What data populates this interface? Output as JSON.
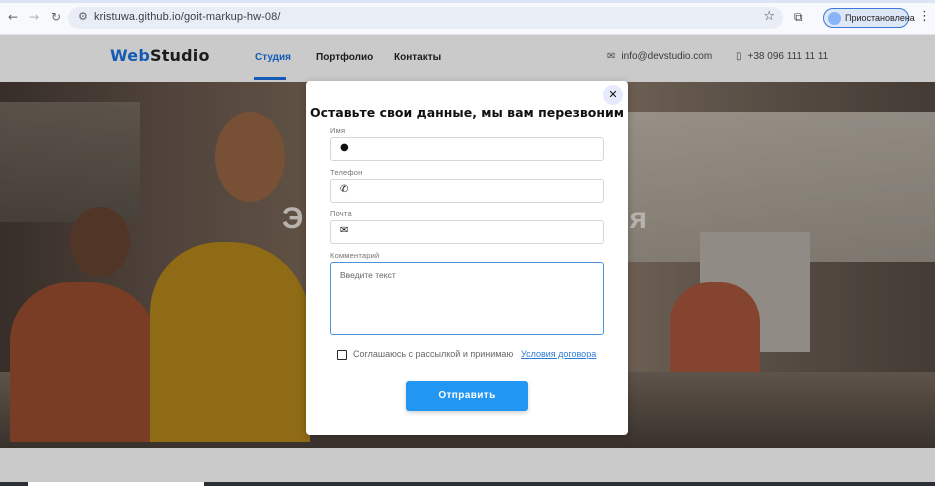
{
  "browser": {
    "url": "kristuwa.github.io/goit-markup-hw-08/",
    "profile_label": "Приостановлена",
    "icons": [
      "back-icon",
      "forward-icon",
      "reload-icon",
      "site-settings-icon",
      "bookmark-star-icon",
      "extensions-icon",
      "menu-dots-icon"
    ]
  },
  "header": {
    "logo_part1": "Web",
    "logo_part2": "Studio",
    "nav": [
      "Студия",
      "Портфолио",
      "Контакты"
    ],
    "active_nav": "Студия",
    "email": "info@devstudio.com",
    "phone": "+38 096 111 11 11",
    "accent_color": "#155bb5"
  },
  "hero": {
    "title_fragment_left": "Э",
    "title_fragment_right": "ия"
  },
  "modal": {
    "title": "Оставьте свои данные, мы вам перезвоним",
    "fields": {
      "name_label": "Имя",
      "phone_label": "Телефон",
      "email_label": "Почта",
      "comment_label": "Комментарий",
      "comment_placeholder": "Введите текст"
    },
    "consent_text": "Соглашаюсь с рассылкой и принимаю",
    "consent_link": "Условия договора",
    "consent_checked": false,
    "submit_label": "Отправить",
    "submit_color": "#2196f3"
  }
}
